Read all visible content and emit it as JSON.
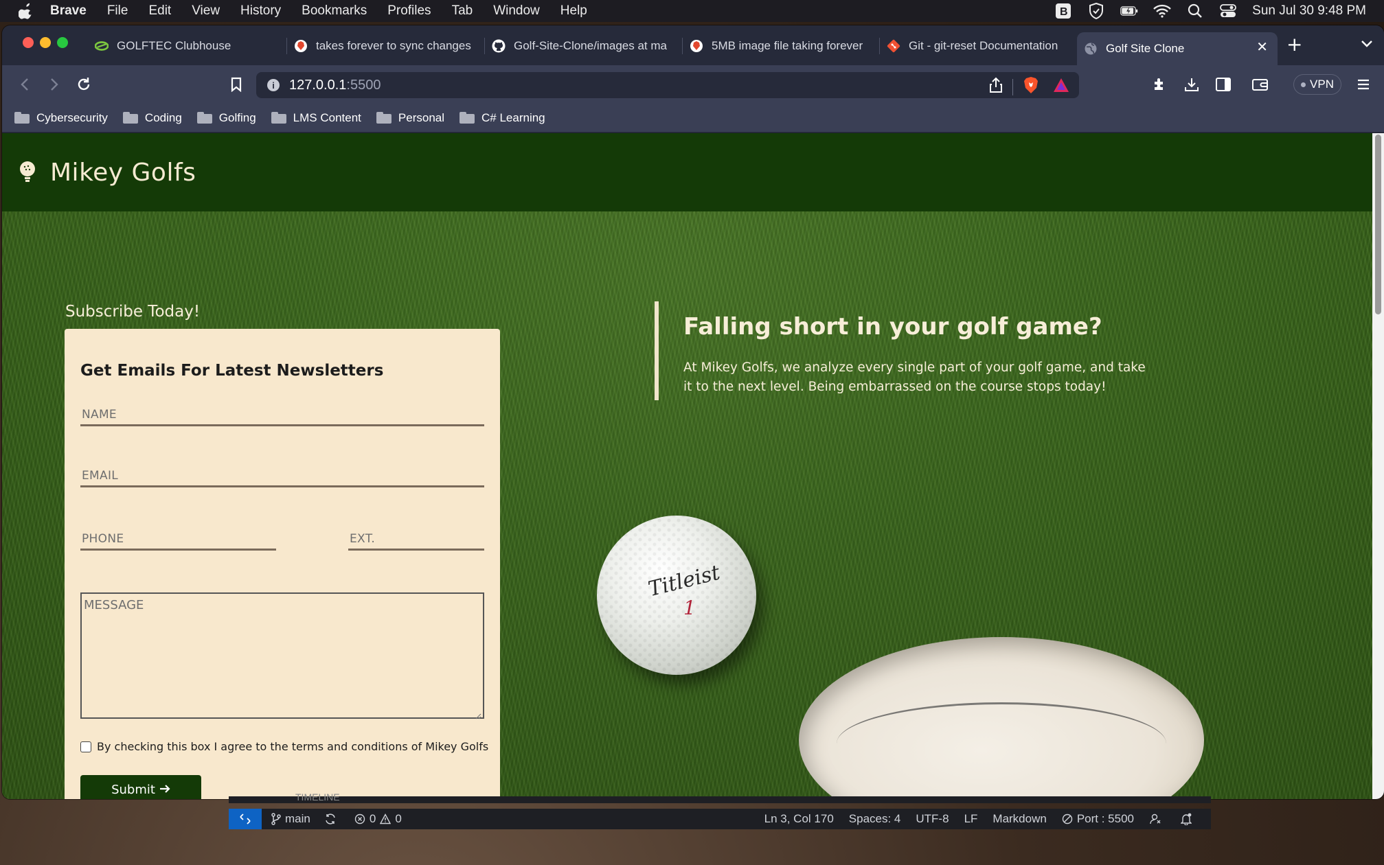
{
  "menubar": {
    "app_name": "Brave",
    "items": [
      "File",
      "Edit",
      "View",
      "History",
      "Bookmarks",
      "Profiles",
      "Tab",
      "Window",
      "Help"
    ],
    "clock": "Sun Jul 30  9:48 PM",
    "status_icons": [
      "brave-rewards-icon",
      "shield-icon",
      "battery-icon",
      "wifi-icon",
      "search-icon",
      "control-center-icon"
    ]
  },
  "browser": {
    "tabs": [
      {
        "title": "GOLFTEC Clubhouse",
        "icon": "golftec-icon"
      },
      {
        "title": "takes forever to sync changes",
        "icon": "brave-icon"
      },
      {
        "title": "Golf-Site-Clone/images at ma",
        "icon": "github-icon"
      },
      {
        "title": "5MB image file taking forever",
        "icon": "brave-icon"
      },
      {
        "title": "Git - git-reset Documentation",
        "icon": "git-icon"
      },
      {
        "title": "Golf Site Clone",
        "icon": "globe-icon",
        "active": true
      }
    ],
    "url": {
      "host": "127.0.0.1",
      "port": ":5500"
    },
    "vpn_label": "VPN",
    "bookmarks": [
      "Cybersecurity",
      "Coding",
      "Golfing",
      "LMS Content",
      "Personal",
      "C# Learning"
    ]
  },
  "site": {
    "title": "Mikey Golfs",
    "subscribe": {
      "heading": "Subscribe Today!",
      "form_title": "Get Emails For Latest Newsletters",
      "name_placeholder": "NAME",
      "email_placeholder": "EMAIL",
      "phone_placeholder": "PHONE",
      "ext_placeholder": "EXT.",
      "message_placeholder": "MESSAGE",
      "terms_label": "By checking this box I agree to the terms and conditions of Mikey Golfs",
      "submit_label": "Submit"
    },
    "promo": {
      "title": "Falling short in your golf game?",
      "body": "At Mikey Golfs, we analyze every single part of your golf game, and take it to the next level. Being embarrassed on the course stops today!"
    },
    "ball": {
      "brand": "Titleist",
      "number": "1"
    }
  },
  "vscode": {
    "timeline_label": "TIMELINE",
    "branch": "main",
    "errors": "0",
    "warnings": "0",
    "position": "Ln 3, Col 170",
    "spaces": "Spaces: 4",
    "encoding": "UTF-8",
    "eol": "LF",
    "language": "Markdown",
    "port": "Port : 5500"
  },
  "colors": {
    "site_header": "#143a07",
    "form_bg": "#f8e8cd",
    "accent_text": "#f7eed8",
    "vscode_remote": "#0e63c4"
  }
}
